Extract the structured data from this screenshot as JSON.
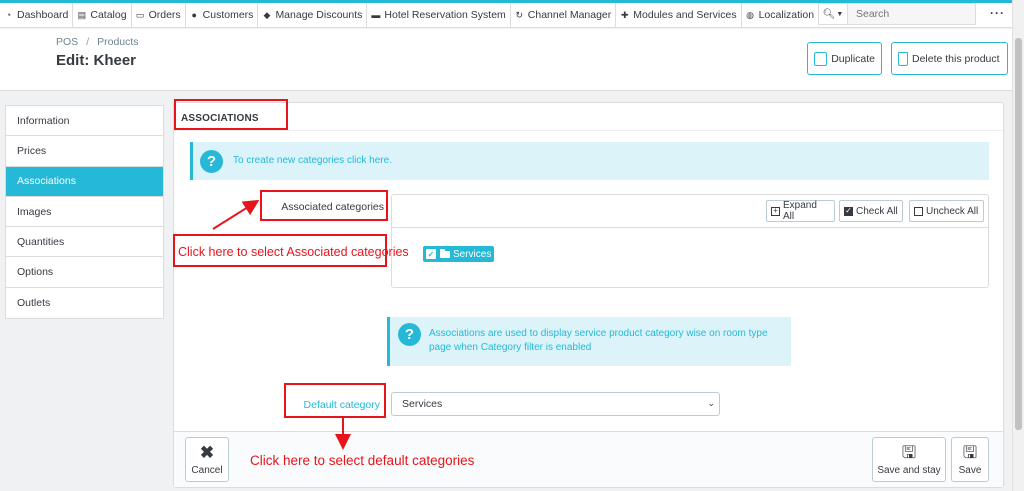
{
  "topnav": {
    "items": [
      {
        "label": "Dashboard",
        "icon": "dashboard-icon"
      },
      {
        "label": "Catalog",
        "icon": "book-icon"
      },
      {
        "label": "Orders",
        "icon": "orders-icon"
      },
      {
        "label": "Customers",
        "icon": "customers-icon"
      },
      {
        "label": "Manage Discounts",
        "icon": "tag-icon"
      },
      {
        "label": "Hotel Reservation System",
        "icon": "bed-icon"
      },
      {
        "label": "Channel Manager",
        "icon": "refresh-icon"
      },
      {
        "label": "Modules and Services",
        "icon": "puzzle-icon"
      },
      {
        "label": "Localization",
        "icon": "globe-icon"
      }
    ],
    "search_placeholder": "Search"
  },
  "header": {
    "breadcrumb": [
      "POS",
      "Products"
    ],
    "title": "Edit: Kheer",
    "duplicate_label": "Duplicate",
    "delete_label": "Delete this product"
  },
  "sidebar": {
    "items": [
      {
        "label": "Information",
        "active": false
      },
      {
        "label": "Prices",
        "active": false
      },
      {
        "label": "Associations",
        "active": true
      },
      {
        "label": "Images",
        "active": false
      },
      {
        "label": "Quantities",
        "active": false
      },
      {
        "label": "Options",
        "active": false
      },
      {
        "label": "Outlets",
        "active": false
      }
    ]
  },
  "panel": {
    "heading": "ASSOCIATIONS",
    "info_alert": {
      "text": "To create new categories ",
      "link": "click here."
    },
    "associated_categories_label": "Associated categories",
    "tree": {
      "expand_all": "Expand All",
      "check_all": "Check All",
      "uncheck_all": "Uncheck All",
      "node_label": "Services"
    },
    "associations_alert": {
      "text_1": "Associations are used to display service product category wise on room type page when ",
      "link": "Category filter",
      "text_2": " is enabled"
    },
    "default_category_label": "Default category",
    "default_category_value": "Services",
    "footer": {
      "cancel": "Cancel",
      "save_and_stay": "Save and stay",
      "save": "Save"
    }
  },
  "annotations": {
    "associated_hint": "Click here to select Associated  categories",
    "default_hint": "Click here to select default categories"
  },
  "colors": {
    "accent": "#25b9d7",
    "annotation_red": "#e8141c"
  }
}
